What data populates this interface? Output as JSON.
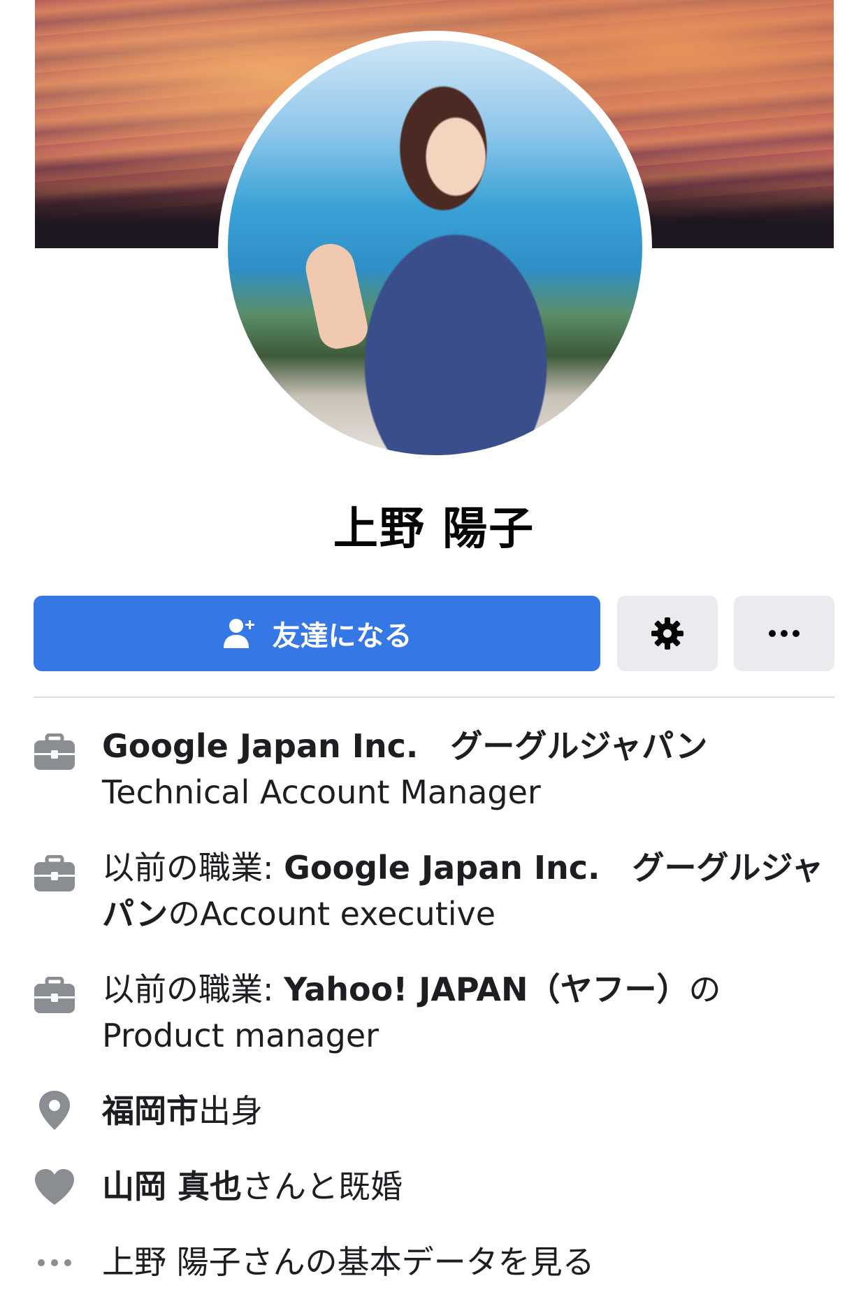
{
  "profile": {
    "name": "上野 陽子"
  },
  "actions": {
    "add_friend_label": "友達になる"
  },
  "info": {
    "work_current": {
      "company": "Google Japan Inc.　グーグルジャパン",
      "title": "Technical Account Manager"
    },
    "work_prev1": {
      "prefix": "以前の職業: ",
      "company_line1": "Google Japan Inc.　グーグルジャ",
      "company_line2": "パン",
      "connector": "の",
      "position": "Account executive"
    },
    "work_prev2": {
      "prefix": "以前の職業: ",
      "company": "Yahoo! JAPAN（ヤフー）",
      "connector": "の",
      "position": "Product manager"
    },
    "hometown": {
      "place": "福岡市",
      "suffix": "出身"
    },
    "relationship": {
      "partner": "山岡 真也",
      "suffix": "さんと既婚"
    },
    "see_more": "上野 陽子さんの基本データを見る"
  },
  "colors": {
    "primary_button": "#3578e5",
    "secondary_button": "#e9ebee",
    "icon_gray": "#8a8d91",
    "text": "#1c1e21"
  },
  "icons": [
    "add-friend-icon",
    "gear-icon",
    "more-icon",
    "briefcase-icon",
    "location-pin-icon",
    "heart-icon",
    "ellipsis-icon"
  ]
}
